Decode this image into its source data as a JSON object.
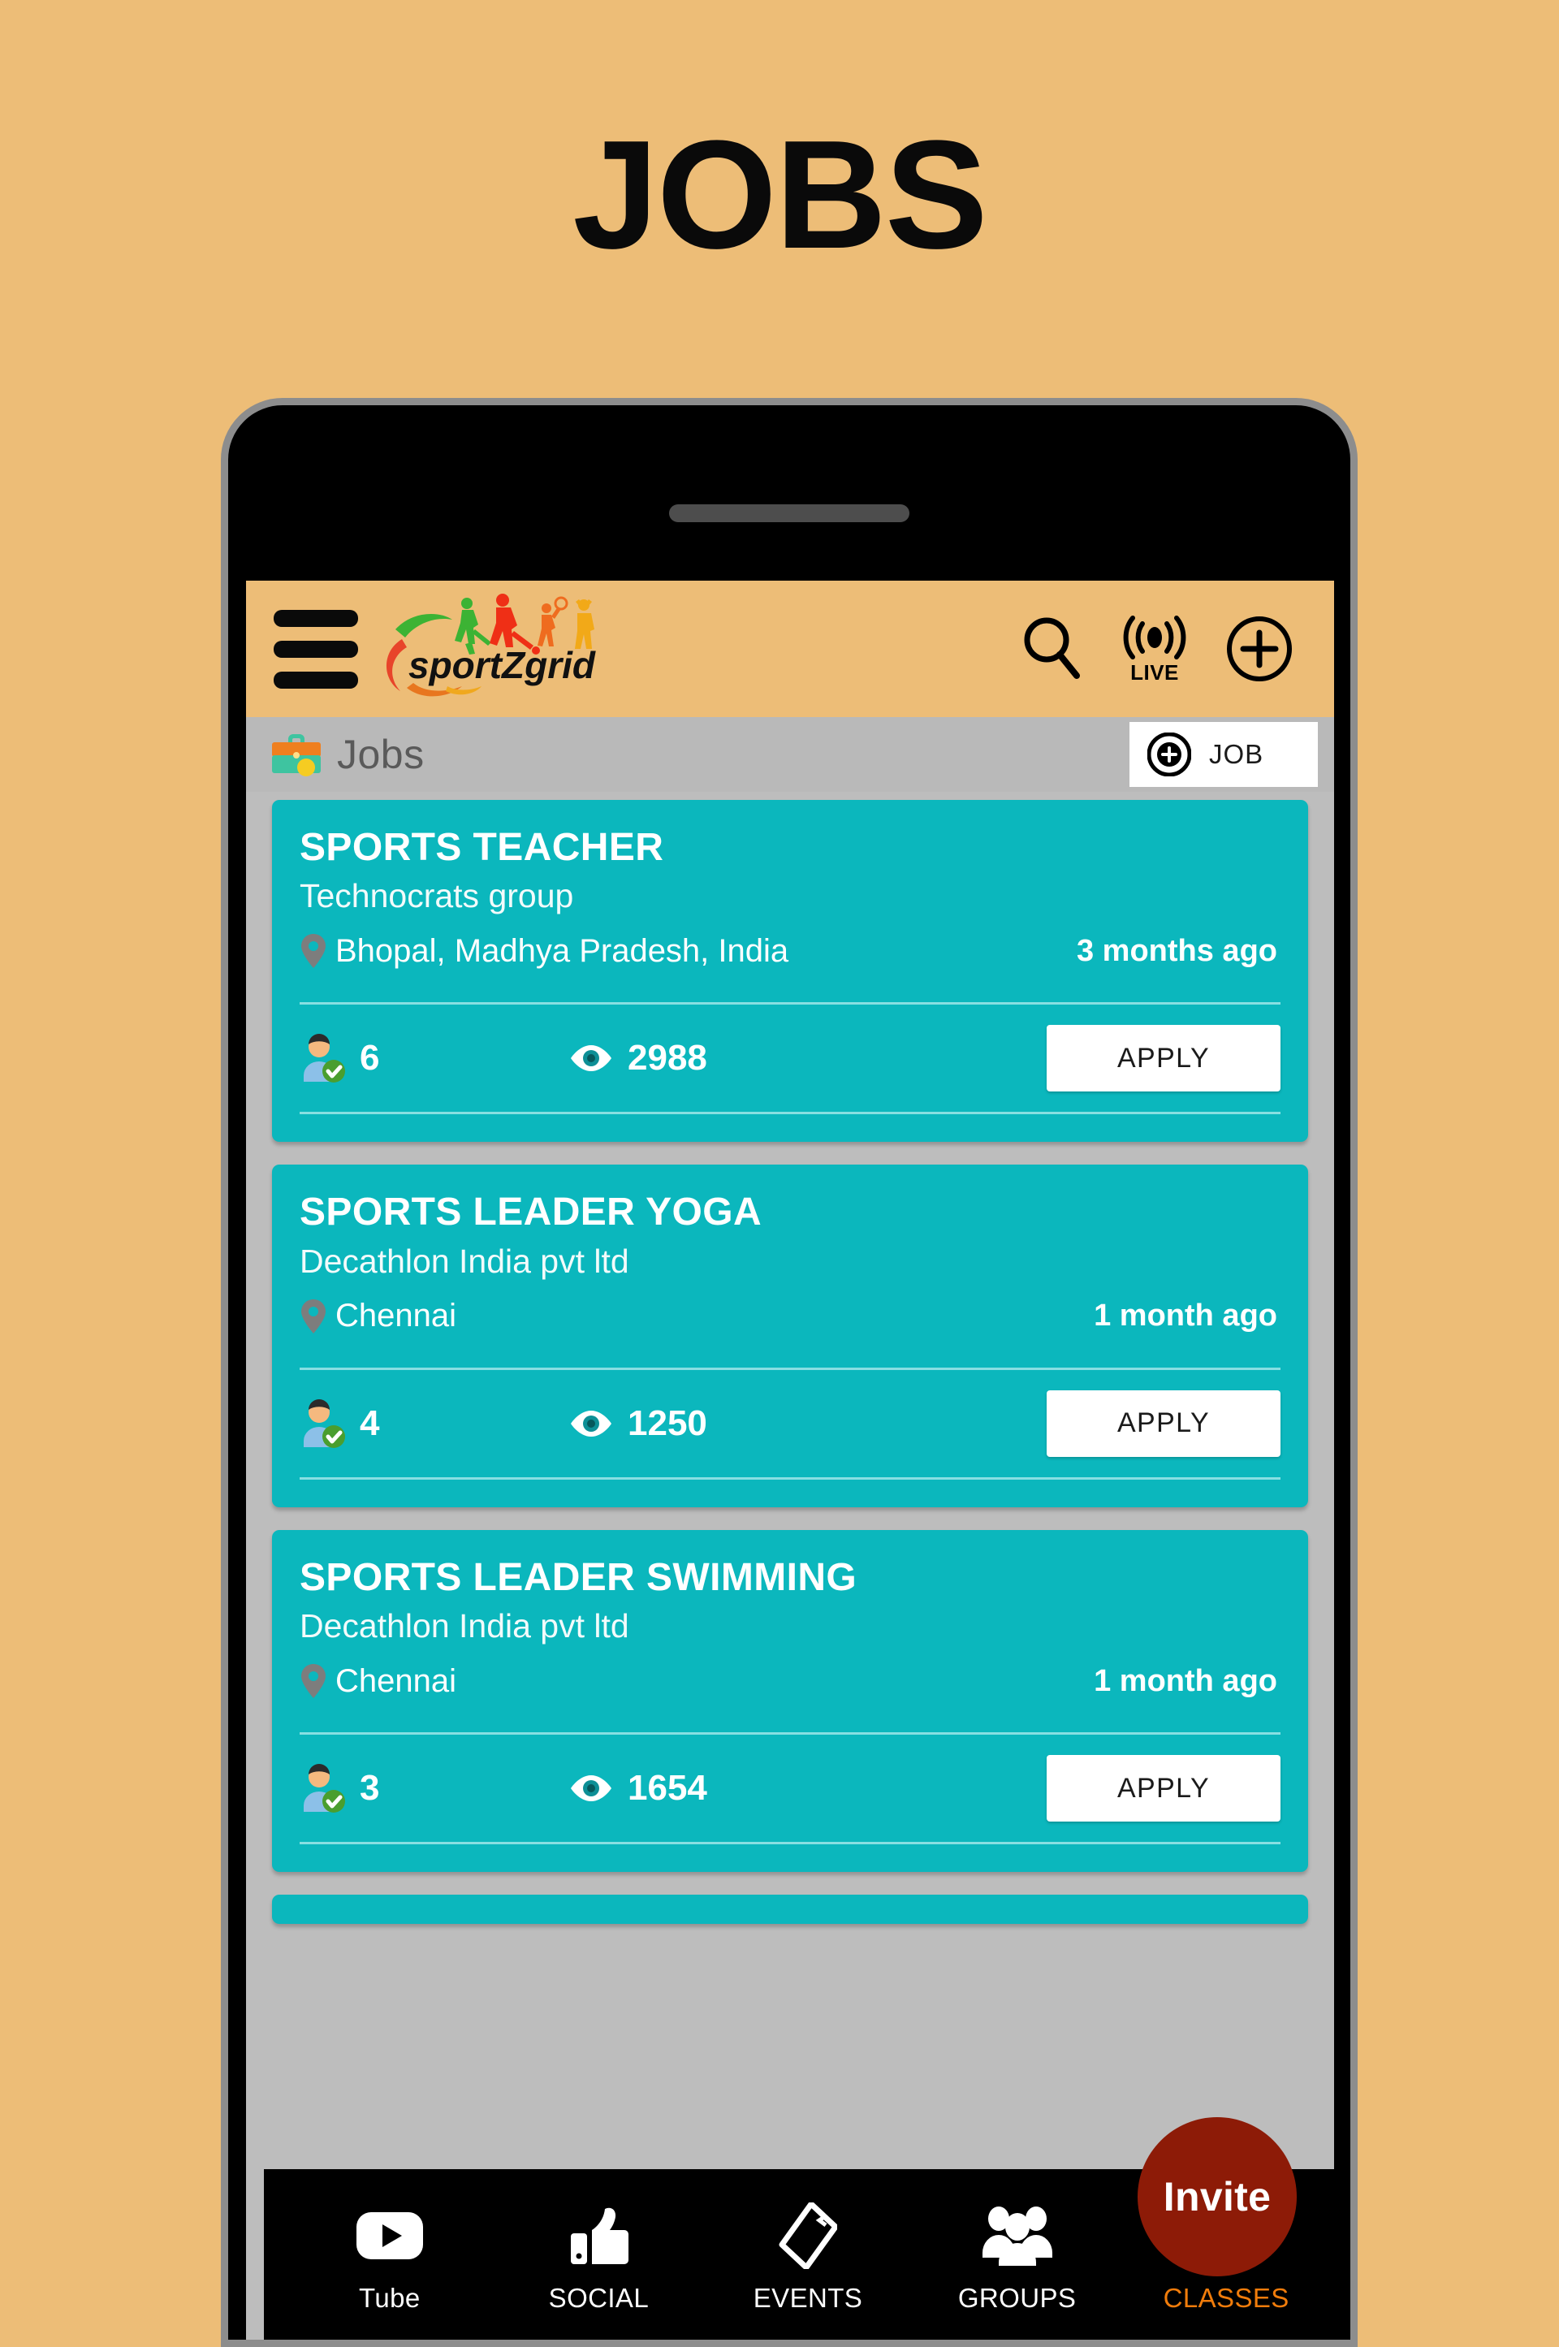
{
  "poster": {
    "title": "JOBS"
  },
  "theme": {
    "background": "#edbd77",
    "card_teal": "#0bb7bd",
    "section_gray": "#b9b9b9",
    "invite_red": "#8d1b07",
    "accent_orange": "#f07c0b"
  },
  "appbar": {
    "menu_icon": "hamburger-menu-icon",
    "brand_name": "sportZgrid",
    "search_icon": "search-icon",
    "live_icon": "live-broadcast-icon",
    "live_label": "LIVE",
    "add_icon": "add-circle-icon"
  },
  "section": {
    "icon": "briefcase-icon",
    "title": "Jobs",
    "post_button": {
      "icon": "add-target-icon",
      "label": "JOB"
    }
  },
  "jobs": [
    {
      "title": "SPORTS TEACHER",
      "company": "Technocrats group",
      "location": "Bhopal, Madhya Pradesh, India",
      "posted": "3 months ago",
      "applicants": "6",
      "views": "2988",
      "apply_label": "APPLY"
    },
    {
      "title": "SPORTS LEADER YOGA",
      "company": "Decathlon India pvt ltd",
      "location": "Chennai",
      "posted": "1 month ago",
      "applicants": "4",
      "views": "1250",
      "apply_label": "APPLY"
    },
    {
      "title": "SPORTS LEADER SWIMMING",
      "company": "Decathlon India pvt ltd",
      "location": "Chennai",
      "posted": "1 month ago",
      "applicants": "3",
      "views": "1654",
      "apply_label": "APPLY"
    }
  ],
  "invite": {
    "label": "Invite"
  },
  "bottom_nav": {
    "items": [
      {
        "label": "Tube",
        "icon": "youtube-play-icon",
        "active": false
      },
      {
        "label": "SOCIAL",
        "icon": "thumbs-up-icon",
        "active": false
      },
      {
        "label": "EVENTS",
        "icon": "ticket-icon",
        "active": false
      },
      {
        "label": "GROUPS",
        "icon": "people-group-icon",
        "active": false
      },
      {
        "label": "CLASSES",
        "icon": "football-icon",
        "active": true
      }
    ]
  }
}
